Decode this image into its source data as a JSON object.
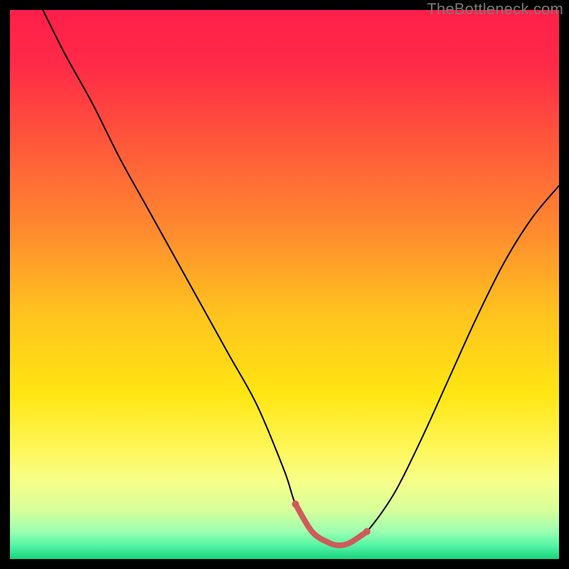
{
  "attribution": "TheBottleneck.com",
  "colors": {
    "page_bg": "#000000",
    "curve": "#000000",
    "accent_segment": "#cf5b5b",
    "gradient_stops": [
      {
        "offset": 0.0,
        "color": "#ff1f4a"
      },
      {
        "offset": 0.1,
        "color": "#ff2a47"
      },
      {
        "offset": 0.25,
        "color": "#ff5a3a"
      },
      {
        "offset": 0.4,
        "color": "#ff8a2f"
      },
      {
        "offset": 0.55,
        "color": "#ffc21f"
      },
      {
        "offset": 0.7,
        "color": "#ffe612"
      },
      {
        "offset": 0.8,
        "color": "#fff75a"
      },
      {
        "offset": 0.86,
        "color": "#f6ff8a"
      },
      {
        "offset": 0.91,
        "color": "#d8ff9a"
      },
      {
        "offset": 0.95,
        "color": "#9dffb1"
      },
      {
        "offset": 0.975,
        "color": "#55f5a6"
      },
      {
        "offset": 1.0,
        "color": "#17d47d"
      }
    ]
  },
  "chart_data": {
    "type": "line",
    "title": "",
    "xlabel": "",
    "ylabel": "",
    "xlim": [
      0,
      100
    ],
    "ylim": [
      0,
      100
    ],
    "grid": false,
    "legend": false,
    "series": [
      {
        "name": "bottleneck-curve",
        "x": [
          6,
          10,
          15,
          20,
          25,
          30,
          35,
          40,
          45,
          50,
          52,
          55,
          58,
          60,
          62,
          65,
          70,
          75,
          80,
          85,
          90,
          95,
          100
        ],
        "y": [
          100,
          92,
          83,
          73,
          64,
          55,
          46,
          37,
          28,
          16,
          10,
          5,
          3,
          2.5,
          3,
          5,
          12,
          22,
          33,
          44,
          54,
          62,
          68
        ]
      },
      {
        "name": "optimal-zone",
        "x": [
          52,
          55,
          58,
          60,
          62,
          65
        ],
        "y": [
          10,
          5,
          3,
          2.5,
          3,
          5
        ]
      }
    ],
    "annotations": []
  }
}
